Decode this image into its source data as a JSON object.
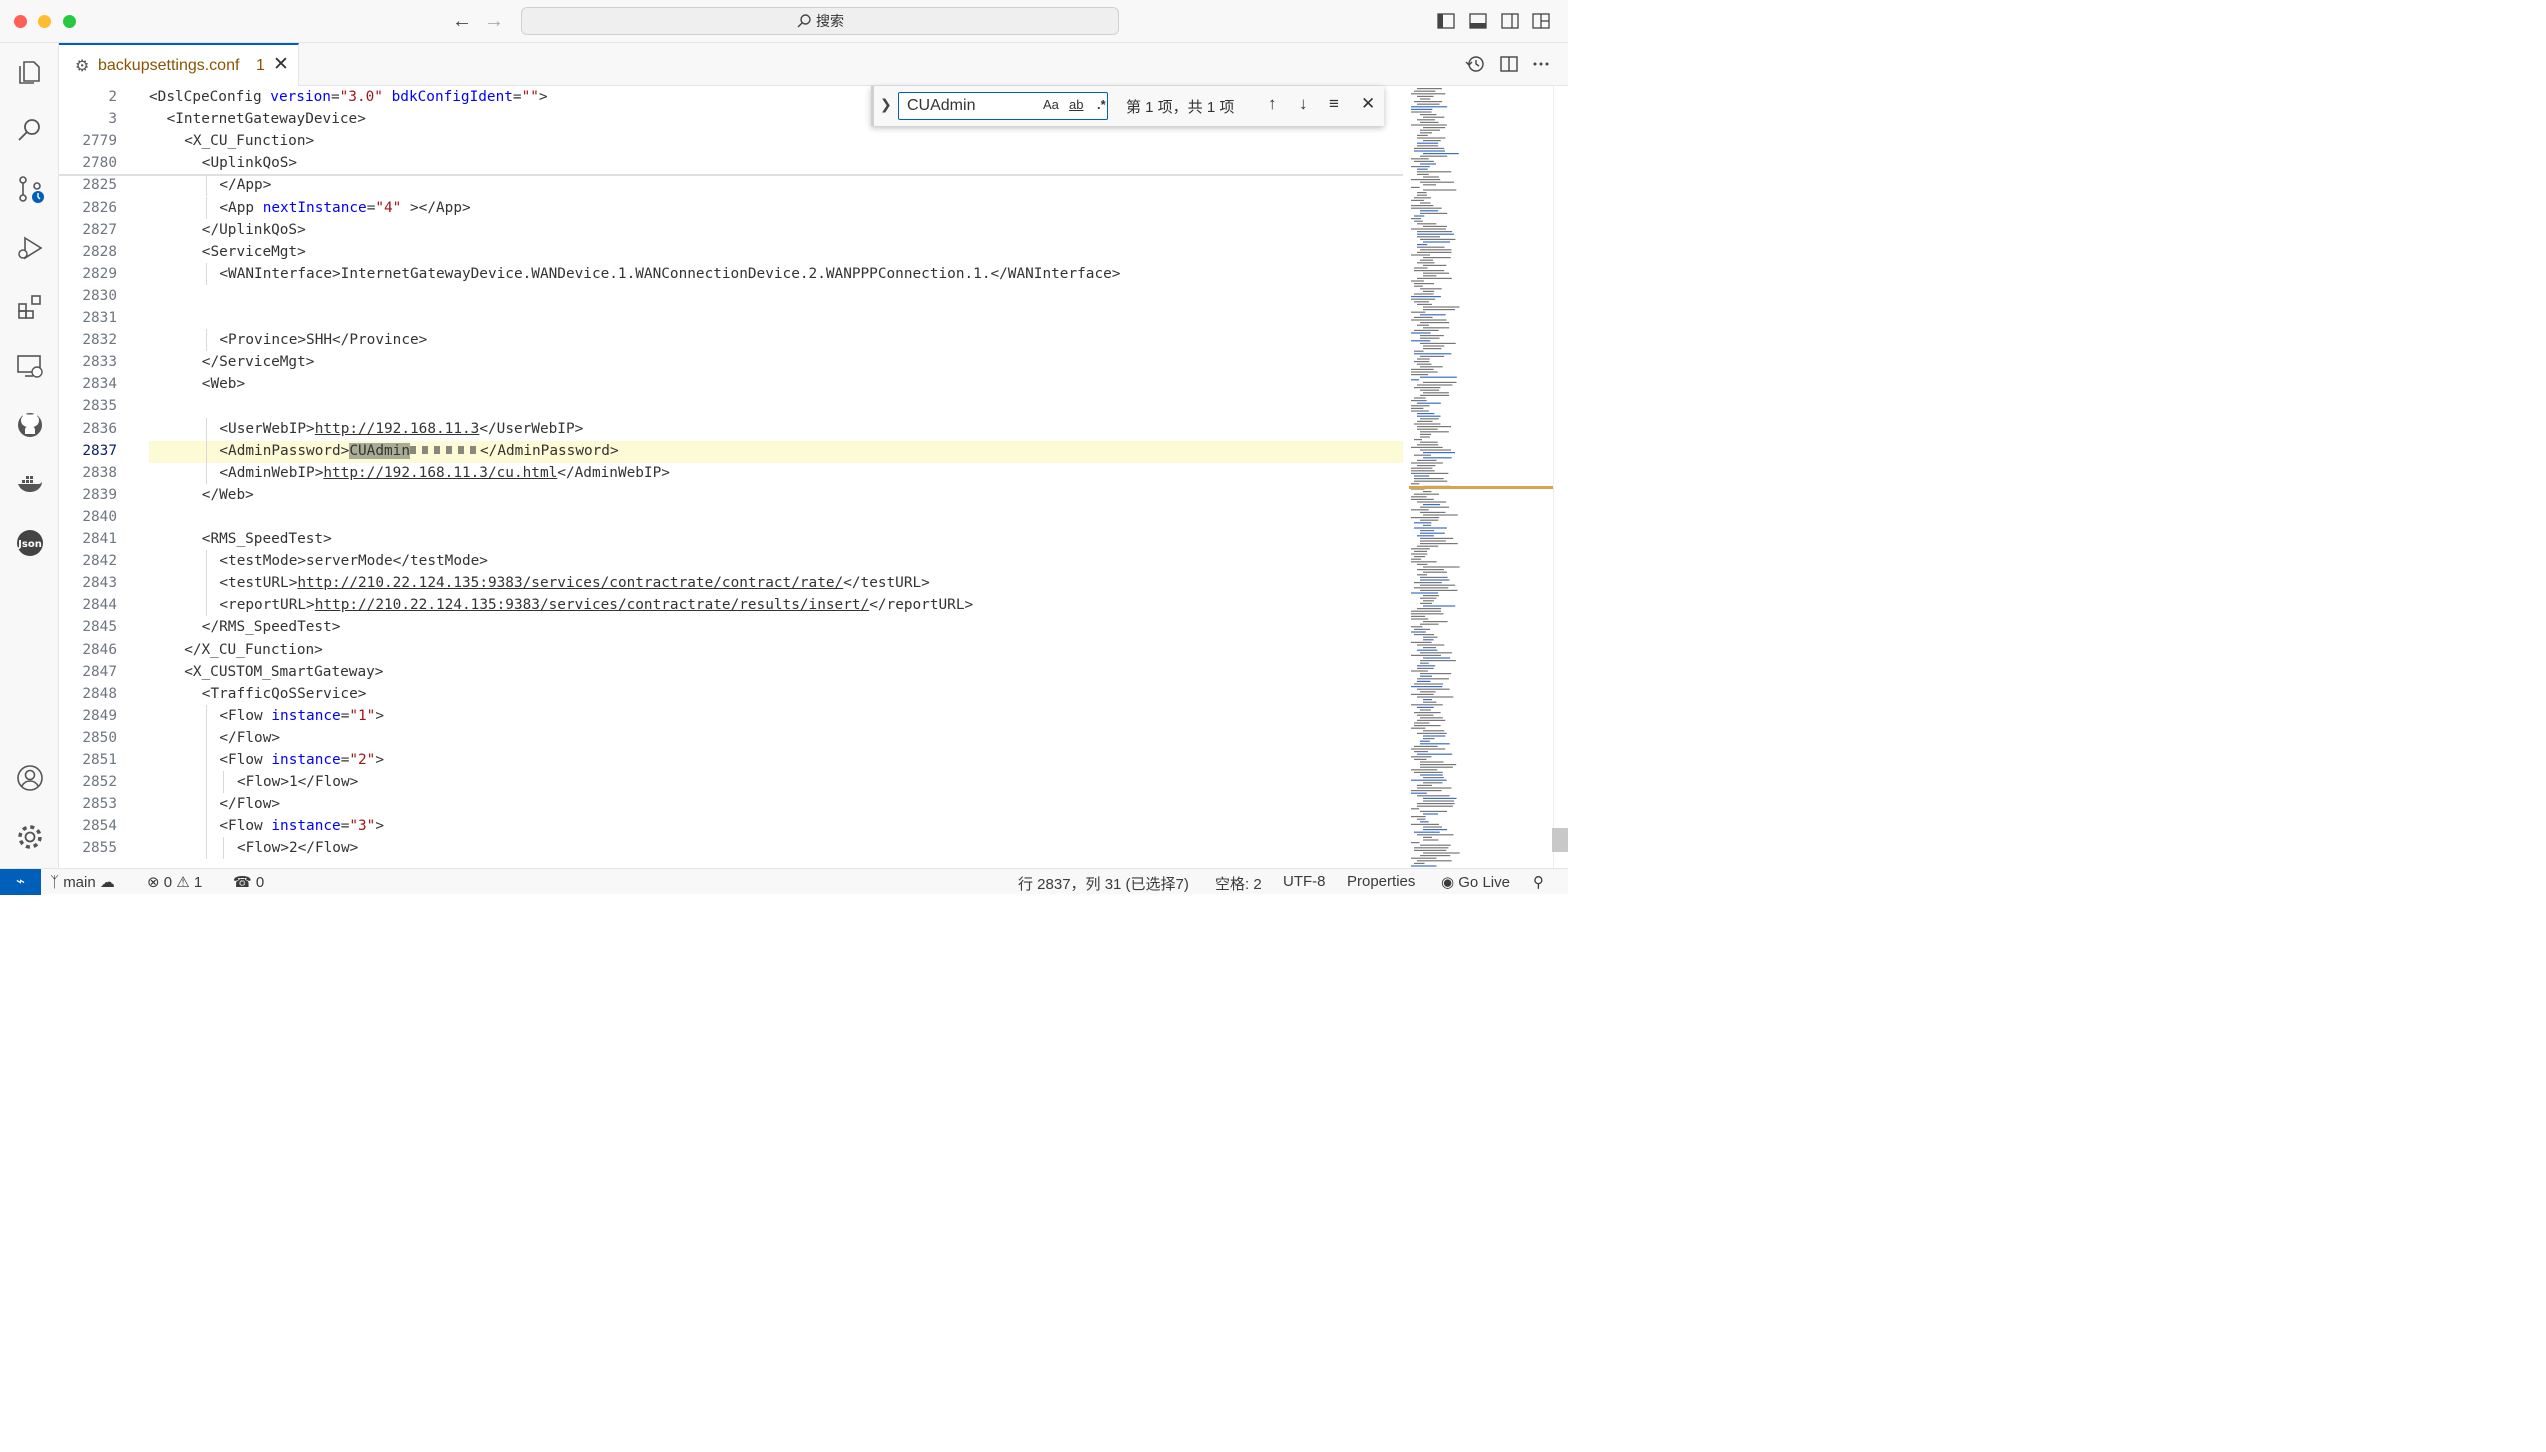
{
  "titlebar": {
    "search_label": "搜索"
  },
  "tab": {
    "filename": "backupsettings.conf",
    "problem_count": "1"
  },
  "find": {
    "query": "CUAdmin",
    "opt_case": "Aa",
    "opt_word": "ab",
    "opt_regex": ".*",
    "result": "第 1 项，共 1 项"
  },
  "editor": {
    "lines": [
      {
        "n": "2",
        "indent": 0,
        "html": "&lt;DslCpeConfig <span class='attr'>version</span>=<span class='str'>\"3.0\"</span> <span class='attr'>bdkConfigIdent</span>=<span class='str'>\"\"</span>&gt;"
      },
      {
        "n": "3",
        "indent": 1,
        "html": "&lt;InternetGatewayDevice&gt;"
      },
      {
        "n": "2779",
        "indent": 2,
        "html": "&lt;X_CU_Function&gt;"
      },
      {
        "n": "2780",
        "indent": 3,
        "html": "&lt;UplinkQoS&gt;"
      },
      {
        "n": "2825",
        "indent": 4,
        "html": "&lt;/App&gt;"
      },
      {
        "n": "2826",
        "indent": 4,
        "html": "&lt;App <span class='attr'>nextInstance</span>=<span class='str'>\"4\"</span> &gt;&lt;/App&gt;"
      },
      {
        "n": "2827",
        "indent": 3,
        "html": "&lt;/UplinkQoS&gt;"
      },
      {
        "n": "2828",
        "indent": 3,
        "html": "&lt;ServiceMgt&gt;"
      },
      {
        "n": "2829",
        "indent": 4,
        "html": "&lt;WANInterface&gt;InternetGatewayDevice.WANDevice.1.WANConnectionDevice.2.WANPPPConnection.1.&lt;/WANInterface&gt;"
      },
      {
        "n": "2830",
        "indent": 0,
        "html": ""
      },
      {
        "n": "2831",
        "indent": 0,
        "html": ""
      },
      {
        "n": "2832",
        "indent": 4,
        "html": "&lt;Province&gt;SHH&lt;/Province&gt;"
      },
      {
        "n": "2833",
        "indent": 3,
        "html": "&lt;/ServiceMgt&gt;"
      },
      {
        "n": "2834",
        "indent": 3,
        "html": "&lt;Web&gt;"
      },
      {
        "n": "2835",
        "indent": 0,
        "html": ""
      },
      {
        "n": "2836",
        "indent": 4,
        "html": "&lt;UserWebIP&gt;<span class='u'>http://192.168.11.3</span>&lt;/UserWebIP&gt;"
      },
      {
        "n": "2837",
        "indent": 4,
        "html": "&lt;AdminPassword&gt;<span class='find-hl'>CUAdmin</span><span class='blur'></span>&lt;/AdminPassword&gt;",
        "current": true
      },
      {
        "n": "2838",
        "indent": 4,
        "html": "&lt;AdminWebIP&gt;<span class='u'>http://192.168.11.3/cu.html</span>&lt;/AdminWebIP&gt;"
      },
      {
        "n": "2839",
        "indent": 3,
        "html": "&lt;/Web&gt;"
      },
      {
        "n": "2840",
        "indent": 0,
        "html": ""
      },
      {
        "n": "2841",
        "indent": 3,
        "html": "&lt;RMS_SpeedTest&gt;"
      },
      {
        "n": "2842",
        "indent": 4,
        "html": "&lt;testMode&gt;serverMode&lt;/testMode&gt;"
      },
      {
        "n": "2843",
        "indent": 4,
        "html": "&lt;testURL&gt;<span class='u'>http://210.22.124.135:9383/services/contractrate/contract/rate/</span>&lt;/testURL&gt;"
      },
      {
        "n": "2844",
        "indent": 4,
        "html": "&lt;reportURL&gt;<span class='u'>http://210.22.124.135:9383/services/contractrate/results/insert/</span>&lt;/reportURL&gt;"
      },
      {
        "n": "2845",
        "indent": 3,
        "html": "&lt;/RMS_SpeedTest&gt;"
      },
      {
        "n": "2846",
        "indent": 2,
        "html": "&lt;/X_CU_Function&gt;"
      },
      {
        "n": "2847",
        "indent": 2,
        "html": "&lt;X_CUSTOM_SmartGateway&gt;"
      },
      {
        "n": "2848",
        "indent": 3,
        "html": "&lt;TrafficQoSService&gt;"
      },
      {
        "n": "2849",
        "indent": 4,
        "html": "&lt;Flow <span class='attr'>instance</span>=<span class='str'>\"1\"</span>&gt;"
      },
      {
        "n": "2850",
        "indent": 4,
        "html": "&lt;/Flow&gt;"
      },
      {
        "n": "2851",
        "indent": 4,
        "html": "&lt;Flow <span class='attr'>instance</span>=<span class='str'>\"2\"</span>&gt;"
      },
      {
        "n": "2852",
        "indent": 5,
        "html": "&lt;Flow&gt;1&lt;/Flow&gt;"
      },
      {
        "n": "2853",
        "indent": 4,
        "html": "&lt;/Flow&gt;"
      },
      {
        "n": "2854",
        "indent": 4,
        "html": "&lt;Flow <span class='attr'>instance</span>=<span class='str'>\"3\"</span>&gt;"
      },
      {
        "n": "2855",
        "indent": 5,
        "html": "&lt;Flow&gt;2&lt;/Flow&gt;"
      }
    ]
  },
  "statusbar": {
    "branch": "main",
    "errors": "0",
    "warnings": "1",
    "ports": "0",
    "cursor": "行 2837，列 31 (已选择7)",
    "spaces": "空格: 2",
    "encoding": "UTF-8",
    "language": "Properties",
    "golive": "Go Live"
  },
  "colors": {
    "accent": "#005fb8",
    "tab_modified": "#895503",
    "current_line": "#fcfbd6"
  }
}
